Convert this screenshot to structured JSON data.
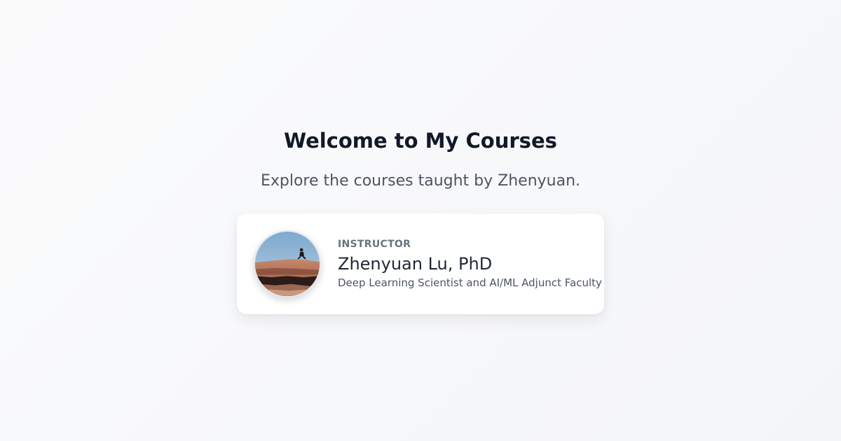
{
  "header": {
    "title": "Welcome to My Courses",
    "subtitle": "Explore the courses taught by Zhenyuan."
  },
  "instructor_card": {
    "role_label": "INSTRUCTOR",
    "name": "Zhenyuan Lu, PhD",
    "description": "Deep Learning Scientist and AI/ML Adjunct Faculty",
    "avatar_icon": "avatar-photo"
  },
  "colors": {
    "title": "#111827",
    "subtitle": "#4b5563",
    "role_label": "#6b7280",
    "name": "#1f2937",
    "card_background": "#ffffff"
  }
}
